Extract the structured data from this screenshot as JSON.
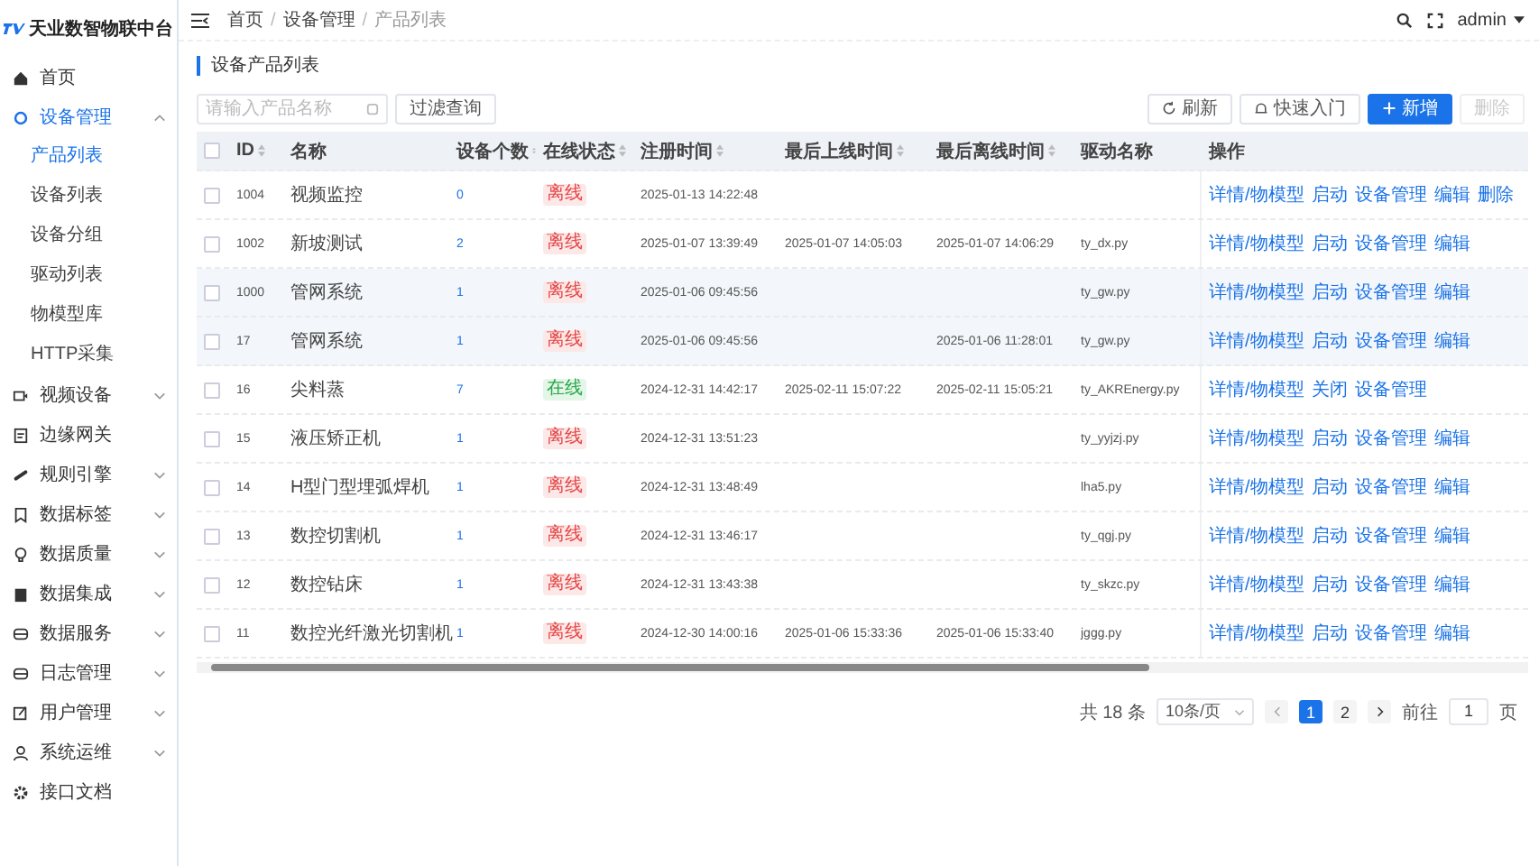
{
  "brand": {
    "title": "天业数智物联中台"
  },
  "sidebar": {
    "items": [
      {
        "label": "首页",
        "expandable": false,
        "expanded": false,
        "active": false
      },
      {
        "label": "设备管理",
        "expandable": true,
        "expanded": true,
        "active": true,
        "children": [
          {
            "label": "产品列表",
            "selected": true
          },
          {
            "label": "设备列表",
            "selected": false
          },
          {
            "label": "设备分组",
            "selected": false
          },
          {
            "label": "驱动列表",
            "selected": false
          },
          {
            "label": "物模型库",
            "selected": false
          },
          {
            "label": "HTTP采集",
            "selected": false
          }
        ]
      },
      {
        "label": "视频设备",
        "expandable": true,
        "expanded": false,
        "active": false
      },
      {
        "label": "边缘网关",
        "expandable": false,
        "expanded": false,
        "active": false
      },
      {
        "label": "规则引擎",
        "expandable": true,
        "expanded": false,
        "active": false
      },
      {
        "label": "数据标签",
        "expandable": true,
        "expanded": false,
        "active": false
      },
      {
        "label": "数据质量",
        "expandable": true,
        "expanded": false,
        "active": false
      },
      {
        "label": "数据集成",
        "expandable": true,
        "expanded": false,
        "active": false
      },
      {
        "label": "数据服务",
        "expandable": true,
        "expanded": false,
        "active": false
      },
      {
        "label": "日志管理",
        "expandable": true,
        "expanded": false,
        "active": false
      },
      {
        "label": "用户管理",
        "expandable": true,
        "expanded": false,
        "active": false
      },
      {
        "label": "系统运维",
        "expandable": true,
        "expanded": false,
        "active": false
      },
      {
        "label": "接口文档",
        "expandable": false,
        "expanded": false,
        "active": false
      }
    ]
  },
  "breadcrumb": [
    "首页",
    "设备管理",
    "产品列表"
  ],
  "breadcrumb_separator": "/",
  "user": {
    "name": "admin"
  },
  "page_title": "设备产品列表",
  "search": {
    "placeholder": "请输入产品名称"
  },
  "filter_button": "过滤查询",
  "toolbar": [
    {
      "label": "刷新",
      "kind": "refresh",
      "disabled": false
    },
    {
      "label": "快速入门",
      "kind": "guide",
      "disabled": false
    },
    {
      "label": "新增",
      "kind": "primary",
      "disabled": false
    },
    {
      "label": "删除",
      "kind": "plain",
      "disabled": true
    }
  ],
  "table": {
    "all_checked": false,
    "columns": [
      {
        "label": "ID",
        "sortable": true
      },
      {
        "label": "名称",
        "sortable": false
      },
      {
        "label": "设备个数",
        "sortable": true
      },
      {
        "label": "在线状态",
        "sortable": true
      },
      {
        "label": "注册时间",
        "sortable": true
      },
      {
        "label": "最后上线时间",
        "sortable": true
      },
      {
        "label": "最后离线时间",
        "sortable": true
      },
      {
        "label": "驱动名称",
        "sortable": false
      },
      {
        "label": "操作",
        "sortable": false
      }
    ],
    "rows": [
      {
        "checked": false,
        "hovered": false,
        "id": "1004",
        "name": "视频监控",
        "count": "0",
        "status": {
          "text": "离线",
          "kind": "offline"
        },
        "registered": "2025-01-13 14:22:48",
        "last_online": "",
        "last_offline": "",
        "driver": "",
        "actions": [
          "详情/物模型",
          "启动",
          "设备管理",
          "编辑",
          "删除"
        ]
      },
      {
        "checked": false,
        "hovered": false,
        "id": "1002",
        "name": "新坡测试",
        "count": "2",
        "status": {
          "text": "离线",
          "kind": "offline"
        },
        "registered": "2025-01-07 13:39:49",
        "last_online": "2025-01-07 14:05:03",
        "last_offline": "2025-01-07 14:06:29",
        "driver": "ty_dx.py",
        "actions": [
          "详情/物模型",
          "启动",
          "设备管理",
          "编辑"
        ]
      },
      {
        "checked": false,
        "hovered": true,
        "id": "1000",
        "name": "管网系统",
        "count": "1",
        "status": {
          "text": "离线",
          "kind": "offline"
        },
        "registered": "2025-01-06 09:45:56",
        "last_online": "",
        "last_offline": "",
        "driver": "ty_gw.py",
        "actions": [
          "详情/物模型",
          "启动",
          "设备管理",
          "编辑"
        ]
      },
      {
        "checked": false,
        "hovered": true,
        "id": "17",
        "name": "管网系统",
        "count": "1",
        "status": {
          "text": "离线",
          "kind": "offline"
        },
        "registered": "2025-01-06 09:45:56",
        "last_online": "",
        "last_offline": "2025-01-06 11:28:01",
        "driver": "ty_gw.py",
        "actions": [
          "详情/物模型",
          "启动",
          "设备管理",
          "编辑"
        ]
      },
      {
        "checked": false,
        "hovered": false,
        "id": "16",
        "name": "尖料蒸",
        "count": "7",
        "status": {
          "text": "在线",
          "kind": "online"
        },
        "registered": "2024-12-31 14:42:17",
        "last_online": "2025-02-11 15:07:22",
        "last_offline": "2025-02-11 15:05:21",
        "driver": "ty_AKREnergy.py",
        "actions": [
          "详情/物模型",
          "关闭",
          "设备管理"
        ]
      },
      {
        "checked": false,
        "hovered": false,
        "id": "15",
        "name": "液压矫正机",
        "count": "1",
        "status": {
          "text": "离线",
          "kind": "offline"
        },
        "registered": "2024-12-31 13:51:23",
        "last_online": "",
        "last_offline": "",
        "driver": "ty_yyjzj.py",
        "actions": [
          "详情/物模型",
          "启动",
          "设备管理",
          "编辑"
        ]
      },
      {
        "checked": false,
        "hovered": false,
        "id": "14",
        "name": "H型门型埋弧焊机",
        "count": "1",
        "status": {
          "text": "离线",
          "kind": "offline"
        },
        "registered": "2024-12-31 13:48:49",
        "last_online": "",
        "last_offline": "",
        "driver": "lha5.py",
        "actions": [
          "详情/物模型",
          "启动",
          "设备管理",
          "编辑"
        ]
      },
      {
        "checked": false,
        "hovered": false,
        "id": "13",
        "name": "数控切割机",
        "count": "1",
        "status": {
          "text": "离线",
          "kind": "offline"
        },
        "registered": "2024-12-31 13:46:17",
        "last_online": "",
        "last_offline": "",
        "driver": "ty_qgj.py",
        "actions": [
          "详情/物模型",
          "启动",
          "设备管理",
          "编辑"
        ]
      },
      {
        "checked": false,
        "hovered": false,
        "id": "12",
        "name": "数控钻床",
        "count": "1",
        "status": {
          "text": "离线",
          "kind": "offline"
        },
        "registered": "2024-12-31 13:43:38",
        "last_online": "",
        "last_offline": "",
        "driver": "ty_skzc.py",
        "actions": [
          "详情/物模型",
          "启动",
          "设备管理",
          "编辑"
        ]
      },
      {
        "checked": false,
        "hovered": false,
        "id": "11",
        "name": "数控光纤激光切割机",
        "count": "1",
        "status": {
          "text": "离线",
          "kind": "offline"
        },
        "registered": "2024-12-30 14:00:16",
        "last_online": "2025-01-06 15:33:36",
        "last_offline": "2025-01-06 15:33:40",
        "driver": "jggg.py",
        "actions": [
          "详情/物模型",
          "启动",
          "设备管理",
          "编辑"
        ]
      }
    ]
  },
  "pagination": {
    "total": "共 18 条",
    "page_size": "10条/页",
    "pages": [
      {
        "label": "1",
        "selected": true
      },
      {
        "label": "2",
        "selected": false
      }
    ],
    "goto_label": "前往",
    "goto_value": "1",
    "goto_unit": "页"
  }
}
